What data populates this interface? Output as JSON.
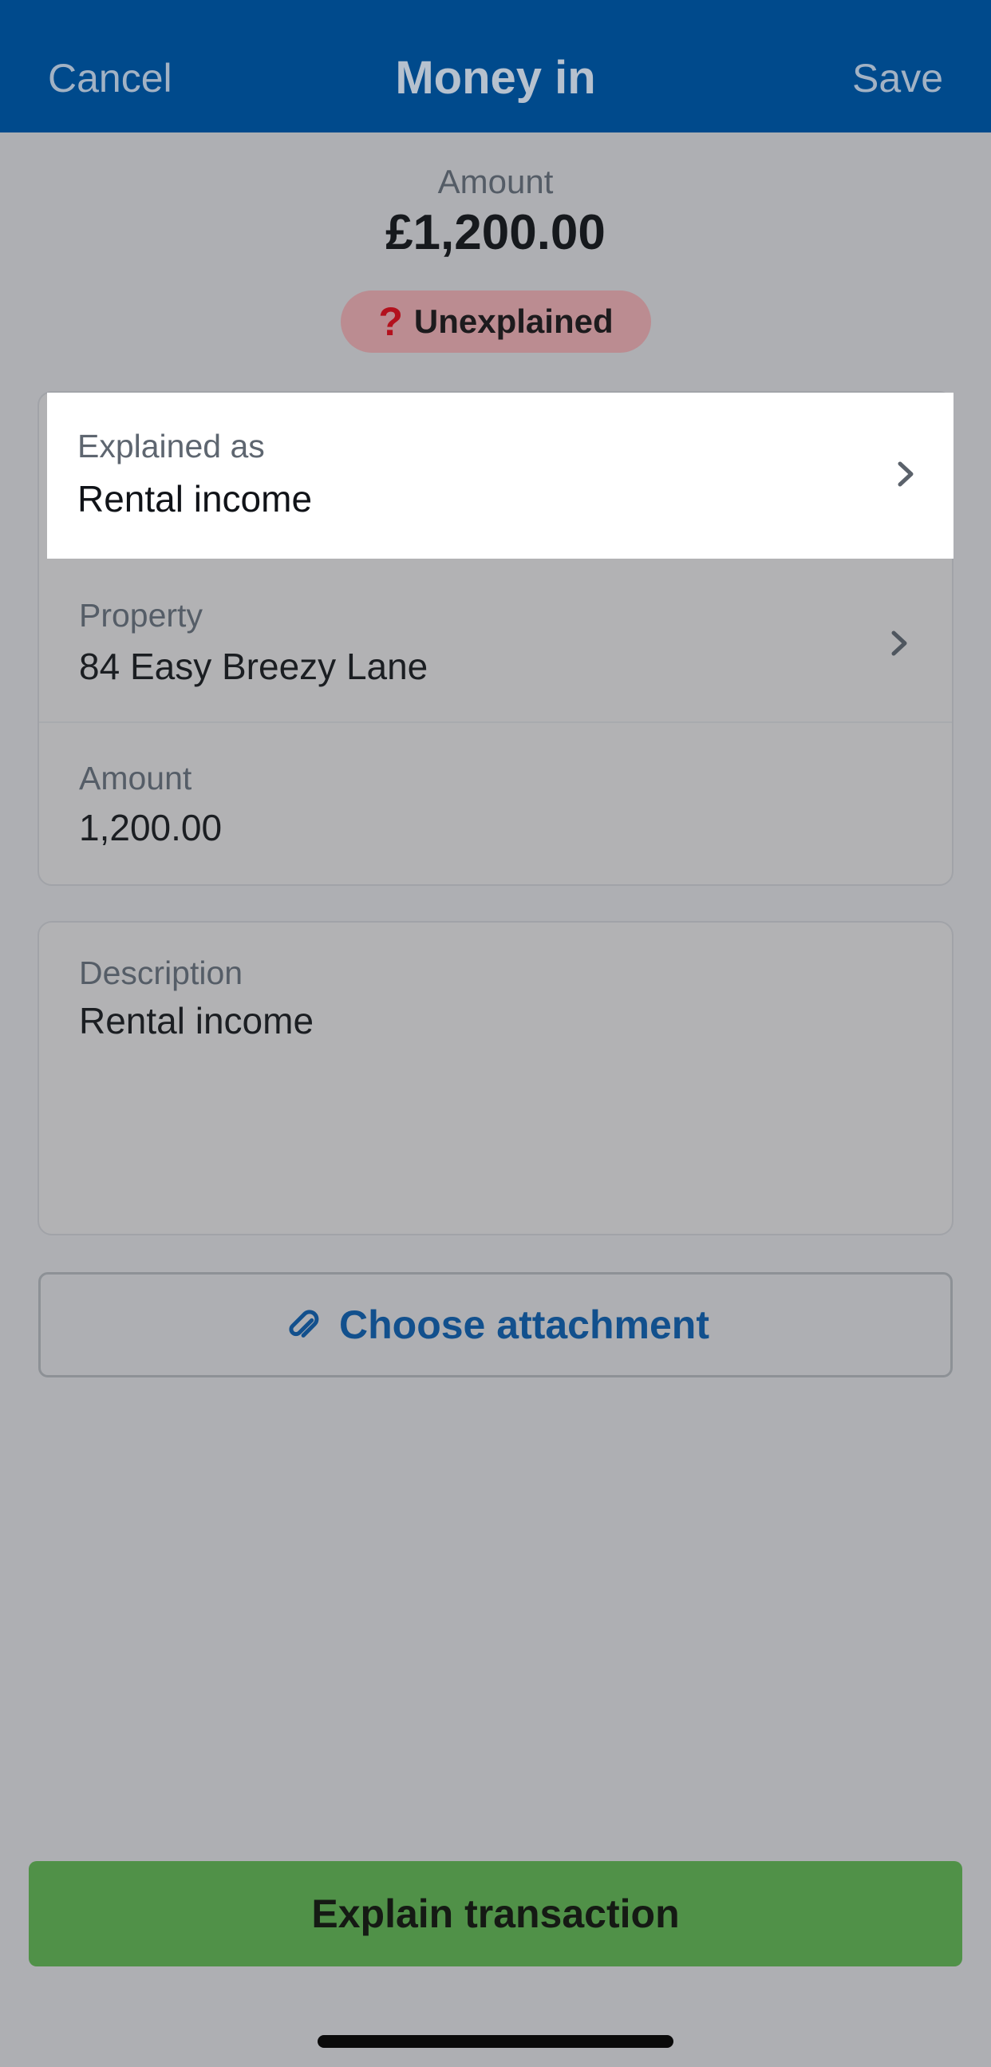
{
  "nav": {
    "cancel_label": "Cancel",
    "title": "Money in",
    "save_label": "Save"
  },
  "summary": {
    "amount_label": "Amount",
    "amount_value": "£1,200.00",
    "status_icon": "question-icon",
    "status_label": "Unexplained",
    "status_color": "#b3111d"
  },
  "details": {
    "explained_as": {
      "label": "Explained as",
      "value": "Rental income"
    },
    "property": {
      "label": "Property",
      "value": "84 Easy Breezy Lane"
    },
    "amount": {
      "label": "Amount",
      "value": "1,200.00"
    }
  },
  "description": {
    "label": "Description",
    "value": "Rental income"
  },
  "attachment": {
    "icon": "paperclip-icon",
    "label": "Choose attachment"
  },
  "footer": {
    "explain_label": "Explain transaction",
    "explain_color": "#509148"
  },
  "colors": {
    "nav_background": "#004a8c",
    "accent_text": "#12508d"
  }
}
